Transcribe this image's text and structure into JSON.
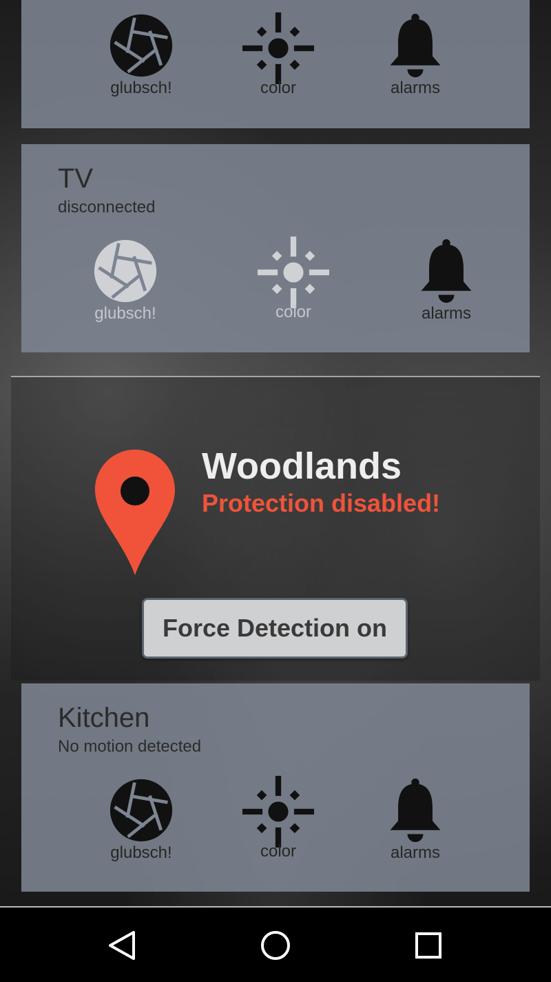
{
  "cards": [
    {
      "title": "",
      "subtitle": "",
      "actions": [
        {
          "label": "glubsch!",
          "icon": "camera-shutter-icon"
        },
        {
          "label": "color",
          "icon": "brightness-icon"
        },
        {
          "label": "alarms",
          "icon": "bell-icon"
        }
      ]
    },
    {
      "title": "TV",
      "subtitle": "disconnected",
      "actions": [
        {
          "label": "glubsch!",
          "icon": "camera-shutter-icon"
        },
        {
          "label": "color",
          "icon": "brightness-icon"
        },
        {
          "label": "alarms",
          "icon": "bell-icon"
        }
      ]
    },
    {
      "title": "Kitchen",
      "subtitle": "No motion detected",
      "actions": [
        {
          "label": "glubsch!",
          "icon": "camera-shutter-icon"
        },
        {
          "label": "color",
          "icon": "brightness-icon"
        },
        {
          "label": "alarms",
          "icon": "bell-icon"
        }
      ]
    }
  ],
  "location": {
    "name": "Woodlands",
    "status": "Protection disabled!",
    "button_label": "Force Detection on",
    "icon": "map-pin-icon",
    "accent_color": "#f0533a"
  },
  "navbar": {
    "icons": [
      "back-triangle-icon",
      "home-circle-icon",
      "recents-square-icon"
    ]
  }
}
